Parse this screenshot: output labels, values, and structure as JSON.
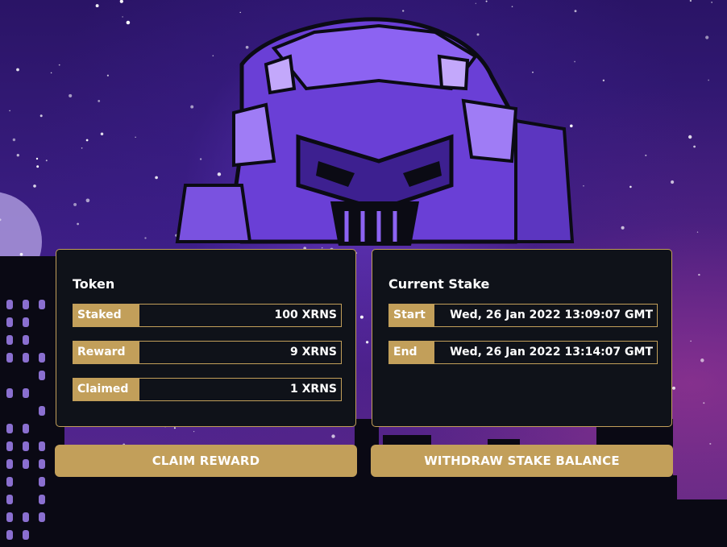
{
  "token_panel": {
    "title": "Token",
    "rows": [
      {
        "label": "Staked",
        "value": "100 XRNS"
      },
      {
        "label": "Reward",
        "value": "9 XRNS"
      },
      {
        "label": "Claimed",
        "value": "1 XRNS"
      }
    ]
  },
  "stake_panel": {
    "title": "Current Stake",
    "rows": [
      {
        "label": "Start",
        "value": "Wed, 26 Jan 2022 13:09:07 GMT"
      },
      {
        "label": "End",
        "value": "Wed, 26 Jan 2022 13:14:07 GMT"
      }
    ]
  },
  "buttons": {
    "claim_label": "CLAIM REWARD",
    "withdraw_label": "WITHDRAW STAKE BALANCE"
  },
  "colors": {
    "accent": "#c29f5a",
    "panel_bg": "#0f1219",
    "sky_top": "#2a1466",
    "sky_bottom": "#5b2b88",
    "robot": "#7d4df0"
  },
  "background_art": [
    "night-sky-stars",
    "moon",
    "robot-illustration",
    "city-skyline-silhouette"
  ]
}
